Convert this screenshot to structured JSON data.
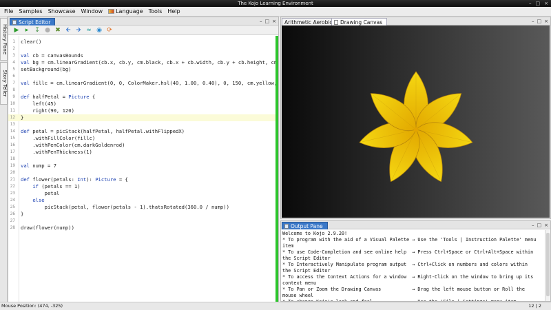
{
  "window": {
    "title": "The Kojo Learning Environment",
    "controls": [
      "–",
      "□",
      "×"
    ]
  },
  "menu": [
    "File",
    "Samples",
    "Showcase",
    "Window",
    "Language",
    "Tools",
    "Help"
  ],
  "side_tabs": [
    "History Pane",
    "Story Teller"
  ],
  "editor": {
    "tab_label": "Script Editor",
    "controls": [
      "–",
      "□",
      "×"
    ],
    "code_lines": [
      {
        "n": "1",
        "text": "clear()"
      },
      {
        "n": "2",
        "text": ""
      },
      {
        "n": "3",
        "text": "val cb = canvasBounds"
      },
      {
        "n": "4",
        "text": "val bg = cm.linearGradient(cb.x, cb.y, cm.black, cb.x + cb.width, cb.y + cb.height, cm.g"
      },
      {
        "n": "5",
        "text": "setBackground(bg)"
      },
      {
        "n": "6",
        "text": ""
      },
      {
        "n": "7",
        "text": "val fillc = cm.linearGradient(0, 0, ColorMaker.hsl(40, 1.00, 0.40), 0, 150, cm.yellow, f"
      },
      {
        "n": "8",
        "text": ""
      },
      {
        "n": "9",
        "text": "def halfPetal = Picture {"
      },
      {
        "n": "10",
        "text": "    left(45)"
      },
      {
        "n": "11",
        "text": "    right(90, 120)"
      },
      {
        "n": "12",
        "text": "}"
      },
      {
        "n": "13",
        "text": ""
      },
      {
        "n": "14",
        "text": "def petal = picStack(halfPetal, halfPetal.withFlippedX)"
      },
      {
        "n": "15",
        "text": "    .withFillColor(fillc)"
      },
      {
        "n": "16",
        "text": "    .withPenColor(cm.darkGoldenrod)"
      },
      {
        "n": "17",
        "text": "    .withPenThickness(1)"
      },
      {
        "n": "18",
        "text": ""
      },
      {
        "n": "19",
        "text": "val nump = 7"
      },
      {
        "n": "20",
        "text": ""
      },
      {
        "n": "21",
        "text": "def flower(petals: Int): Picture = {"
      },
      {
        "n": "22",
        "text": "    if (petals == 1)"
      },
      {
        "n": "23",
        "text": "        petal"
      },
      {
        "n": "24",
        "text": "    else"
      },
      {
        "n": "25",
        "text": "        picStack(petal, flower(petals - 1).thatsRotated(360.0 / nump))"
      },
      {
        "n": "26",
        "text": "}"
      },
      {
        "n": "27",
        "text": ""
      },
      {
        "n": "28",
        "text": "draw(flower(nump))"
      }
    ],
    "highlighted_line": "12"
  },
  "canvas": {
    "tabs": [
      "Arithmetic Aerobics",
      "Drawing Canvas"
    ],
    "active_tab": "Drawing Canvas",
    "controls": [
      "–",
      "□",
      "×"
    ],
    "petal_count": 7,
    "colors": {
      "petal_fill": "#f2cf0a",
      "petal_stroke": "#b8860b",
      "center": "#e3a300"
    }
  },
  "output": {
    "tab_label": "Output Pane",
    "controls": [
      "–",
      "□",
      "×"
    ],
    "lines": [
      "Welcome to Kojo 2.9.20!",
      "* To program with the aid of a Visual Palette → Use the 'Tools | Instruction Palette' menu",
      "item",
      "* To use Code-Completion and see online help  → Press Ctrl+Space or Ctrl+Alt+Space within",
      "the Script Editor",
      "* To Interactively Manipulate program output  → Ctrl+Click on numbers and colors within",
      "the Script Editor",
      "* To access the Context Actions for a window  → Right-Click on the window to bring up its",
      "context menu",
      "* To Pan or Zoom the Drawing Canvas           → Drag the left mouse button or Roll the",
      "mouse wheel",
      "* To change Kojo's look and feel              → Use the 'File | Settings' menu item"
    ]
  },
  "status": {
    "mouse_position": "Mouse Position: (474, -325)",
    "cursor": "12 | 2"
  }
}
